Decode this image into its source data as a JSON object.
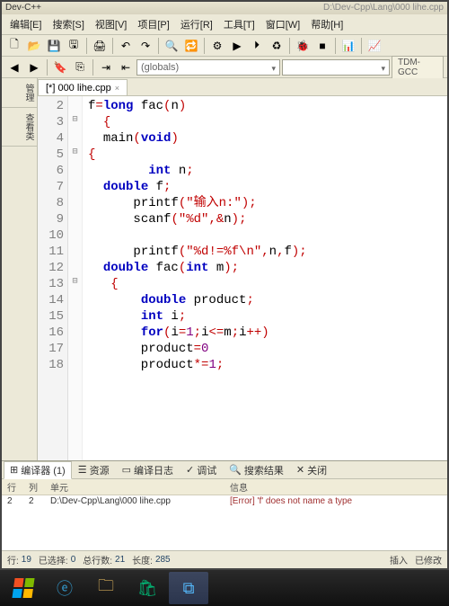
{
  "title": "Dev-C++",
  "title_path": "D:\\Dev-Cpp\\Lang\\000 lihe.cpp",
  "menus": [
    "编辑[E]",
    "搜索[S]",
    "视图[V]",
    "项目[P]",
    "运行[R]",
    "工具[T]",
    "窗口[W]",
    "帮助[H]"
  ],
  "toolbar_icons": [
    "new-file",
    "open-file",
    "save",
    "save-all",
    "|",
    "print",
    "|",
    "undo",
    "redo",
    "|",
    "find",
    "replace",
    "|",
    "compile",
    "run",
    "compile-run",
    "rebuild",
    "|",
    "debug",
    "stop",
    "|",
    "profile",
    "|",
    "chart"
  ],
  "toolbar2_icons": [
    "back",
    "fwd",
    "|",
    "toggle-bookmark",
    "goto-bookmark",
    "|",
    "indent",
    "outdent"
  ],
  "scope_combo": "(globals)",
  "member_combo": "",
  "tdm_label": "TDM-GCC",
  "side_tabs": [
    "管理",
    "查看类"
  ],
  "file_tab": "[*] 000 lihe.cpp",
  "code_lines": [
    {
      "n": 2,
      "fold": "",
      "tokens": [
        [
          "id",
          "f"
        ],
        [
          "punc",
          "="
        ],
        [
          "kw",
          "long "
        ],
        [
          "fn",
          "fac"
        ],
        [
          "punc",
          "("
        ],
        [
          "id",
          "n"
        ],
        [
          "punc",
          ")"
        ]
      ]
    },
    {
      "n": 3,
      "fold": "⊟",
      "tokens": [
        [
          "id",
          "  "
        ],
        [
          "brace",
          "{"
        ]
      ]
    },
    {
      "n": 4,
      "fold": "",
      "tokens": [
        [
          "id",
          "  "
        ],
        [
          "fn",
          "main"
        ],
        [
          "punc",
          "("
        ],
        [
          "kw",
          "void"
        ],
        [
          "punc",
          ")"
        ]
      ]
    },
    {
      "n": 5,
      "fold": "⊟",
      "tokens": [
        [
          "brace",
          "{"
        ]
      ]
    },
    {
      "n": 6,
      "fold": "",
      "tokens": [
        [
          "id",
          "        "
        ],
        [
          "kw",
          "int "
        ],
        [
          "id",
          "n"
        ],
        [
          "punc",
          ";"
        ]
      ]
    },
    {
      "n": 7,
      "fold": "",
      "tokens": [
        [
          "id",
          "  "
        ],
        [
          "kw",
          "double "
        ],
        [
          "id",
          "f"
        ],
        [
          "punc",
          ";"
        ]
      ]
    },
    {
      "n": 8,
      "fold": "",
      "tokens": [
        [
          "id",
          "      "
        ],
        [
          "fn",
          "printf"
        ],
        [
          "punc",
          "("
        ],
        [
          "str",
          "\"输入n:\""
        ],
        [
          "punc",
          ");"
        ]
      ]
    },
    {
      "n": 9,
      "fold": "",
      "tokens": [
        [
          "id",
          "      "
        ],
        [
          "fn",
          "scanf"
        ],
        [
          "punc",
          "("
        ],
        [
          "str",
          "\"%d\""
        ],
        [
          "punc",
          ",&"
        ],
        [
          "id",
          "n"
        ],
        [
          "punc",
          ");"
        ]
      ]
    },
    {
      "n": 10,
      "fold": "",
      "tokens": []
    },
    {
      "n": 11,
      "fold": "",
      "tokens": [
        [
          "id",
          "      "
        ],
        [
          "fn",
          "printf"
        ],
        [
          "punc",
          "("
        ],
        [
          "str",
          "\"%d!=%f\\n\""
        ],
        [
          "punc",
          ","
        ],
        [
          "id",
          "n"
        ],
        [
          "punc",
          ","
        ],
        [
          "id",
          "f"
        ],
        [
          "punc",
          ");"
        ]
      ]
    },
    {
      "n": 12,
      "fold": "",
      "tokens": [
        [
          "id",
          "  "
        ],
        [
          "kw",
          "double "
        ],
        [
          "fn",
          "fac"
        ],
        [
          "punc",
          "("
        ],
        [
          "kw",
          "int "
        ],
        [
          "id",
          "m"
        ],
        [
          "punc",
          ");"
        ]
      ]
    },
    {
      "n": 13,
      "fold": "⊟",
      "tokens": [
        [
          "id",
          "   "
        ],
        [
          "brace",
          "{"
        ]
      ]
    },
    {
      "n": 14,
      "fold": "",
      "tokens": [
        [
          "id",
          "       "
        ],
        [
          "kw",
          "double "
        ],
        [
          "id",
          "product"
        ],
        [
          "punc",
          ";"
        ]
      ]
    },
    {
      "n": 15,
      "fold": "",
      "tokens": [
        [
          "id",
          "       "
        ],
        [
          "kw",
          "int "
        ],
        [
          "id",
          "i"
        ],
        [
          "punc",
          ";"
        ]
      ]
    },
    {
      "n": 16,
      "fold": "",
      "tokens": [
        [
          "id",
          "       "
        ],
        [
          "kw",
          "for"
        ],
        [
          "punc",
          "("
        ],
        [
          "id",
          "i"
        ],
        [
          "punc",
          "="
        ],
        [
          "num",
          "1"
        ],
        [
          "punc",
          ";"
        ],
        [
          "id",
          "i"
        ],
        [
          "punc",
          "<="
        ],
        [
          "id",
          "m"
        ],
        [
          "punc",
          ";"
        ],
        [
          "id",
          "i"
        ],
        [
          "punc",
          "++)"
        ]
      ]
    },
    {
      "n": 17,
      "fold": "",
      "tokens": [
        [
          "id",
          "       product"
        ],
        [
          "punc",
          "="
        ],
        [
          "num",
          "0"
        ]
      ]
    },
    {
      "n": 18,
      "fold": "",
      "tokens": [
        [
          "id",
          "       product"
        ],
        [
          "punc",
          "*="
        ],
        [
          "num",
          "1"
        ],
        [
          "punc",
          ";"
        ]
      ]
    }
  ],
  "bottom_tabs": [
    {
      "icon": "⊞",
      "label": "编译器 (1)",
      "active": true
    },
    {
      "icon": "☰",
      "label": "资源"
    },
    {
      "icon": "▭",
      "label": "编译日志"
    },
    {
      "icon": "✓",
      "label": "调试"
    },
    {
      "icon": "🔍",
      "label": "搜索结果"
    },
    {
      "icon": "✕",
      "label": "关闭"
    }
  ],
  "bp_headers": {
    "line": "行",
    "col": "列",
    "unit": "单元",
    "msg": "信息"
  },
  "bp_row": {
    "line": "2",
    "col": "2",
    "unit": "D:\\Dev-Cpp\\Lang\\000 lihe.cpp",
    "msg": "[Error] 'f' does not name a type"
  },
  "status": {
    "line_lbl": "行:",
    "line": "19",
    "sel_lbl": "已选择:",
    "sel": "0",
    "total_lbl": "总行数:",
    "total": "21",
    "len_lbl": "长度:",
    "len": "285",
    "ins": "插入",
    "mod": "已修改"
  }
}
